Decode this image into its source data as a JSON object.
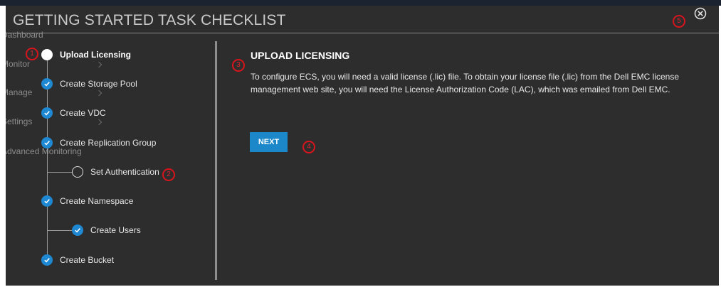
{
  "modal": {
    "title": "GETTING STARTED TASK CHECKLIST",
    "close_icon": "close-circle-icon"
  },
  "background_nav": {
    "items": [
      "Dashboard",
      "Monitor",
      "Manage",
      "Settings",
      "Advanced Monitoring"
    ]
  },
  "steps": [
    {
      "label": "Upload Licensing",
      "state": "current",
      "level": 0
    },
    {
      "label": "Create Storage Pool",
      "state": "done",
      "level": 0
    },
    {
      "label": "Create VDC",
      "state": "done",
      "level": 0
    },
    {
      "label": "Create Replication Group",
      "state": "done",
      "level": 0
    },
    {
      "label": "Set Authentication",
      "state": "pending",
      "level": 1
    },
    {
      "label": "Create Namespace",
      "state": "done",
      "level": 0
    },
    {
      "label": "Create Users",
      "state": "done",
      "level": 1
    },
    {
      "label": "Create Bucket",
      "state": "done",
      "level": 0
    }
  ],
  "content": {
    "heading": "UPLOAD LICENSING",
    "body": "To configure ECS, you will need a valid license (.lic) file. To obtain your license file (.lic) from the Dell EMC license management web site, you will need the License Authorization Code (LAC), which was emailed from Dell EMC.",
    "next_label": "NEXT"
  },
  "callouts": [
    "1",
    "2",
    "3",
    "4",
    "5"
  ],
  "colors": {
    "modal_bg": "#2d2d2d",
    "accent": "#1e88d2",
    "callout": "#d8141c"
  }
}
